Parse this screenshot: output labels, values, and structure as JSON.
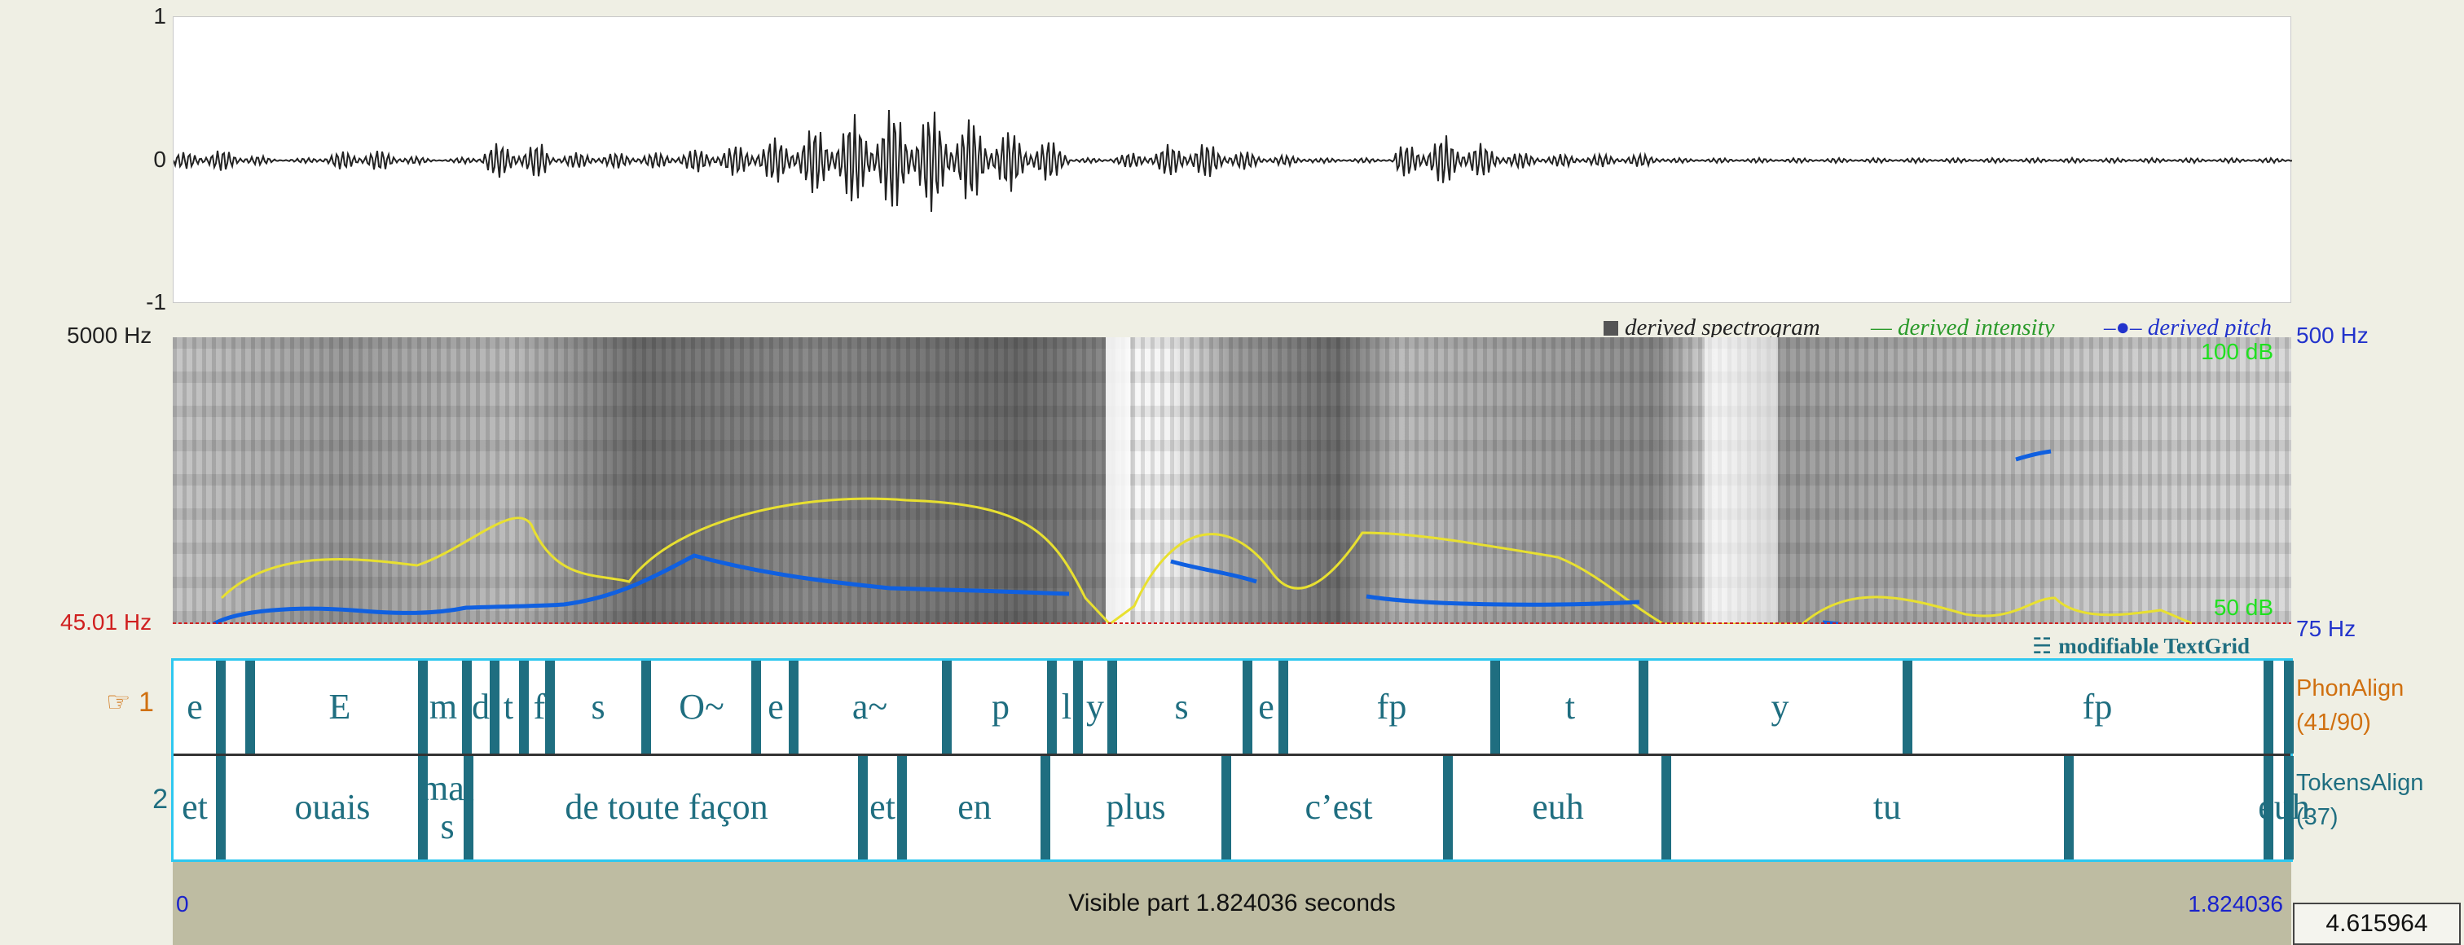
{
  "waveform": {
    "y_top": "1",
    "y_mid": "0",
    "y_bottom": "-1"
  },
  "spectrogram": {
    "freq_top": "5000 Hz",
    "freq_cursor": "45.01 Hz",
    "pitch_top": "500 Hz",
    "pitch_bottom": "75 Hz",
    "intensity_top": "100 dB",
    "intensity_bottom": "50 dB",
    "legend": {
      "spectrogram": "derived spectrogram",
      "intensity": "derived intensity",
      "pitch": "derived pitch"
    },
    "colors": {
      "intensity": "#e8e030",
      "pitch": "#1060e0",
      "cursor": "#d02020"
    }
  },
  "textgrid": {
    "modifiable_label": "modifiable TextGrid",
    "tier1": {
      "number": "1",
      "name": "PhonAlign",
      "count": "(41/90)",
      "intervals": [
        "e",
        "E",
        "m",
        "d",
        "t",
        "f",
        "s",
        "O~",
        "e",
        "a~",
        "p",
        "l",
        "y",
        "s",
        "e",
        "fp",
        "t",
        "y",
        "fp"
      ]
    },
    "tier2": {
      "number": "2",
      "name": "TokensAlign",
      "count": "(37)",
      "intervals": [
        "et",
        "ouais",
        "mai s",
        "de toute façon",
        "et",
        "en",
        "plus",
        "c’est",
        "euh",
        "tu",
        "euh"
      ]
    }
  },
  "bottom_bar": {
    "start": "0",
    "visible_part": "Visible part 1.824036 seconds",
    "end": "1.824036",
    "total_duration": "4.615964"
  }
}
